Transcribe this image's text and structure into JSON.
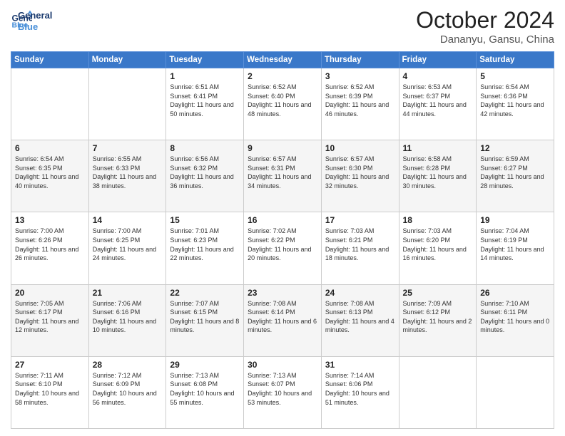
{
  "logo": {
    "line1": "General",
    "line2": "Blue"
  },
  "title": "October 2024",
  "location": "Dananyu, Gansu, China",
  "weekdays": [
    "Sunday",
    "Monday",
    "Tuesday",
    "Wednesday",
    "Thursday",
    "Friday",
    "Saturday"
  ],
  "weeks": [
    [
      {
        "day": "",
        "info": ""
      },
      {
        "day": "",
        "info": ""
      },
      {
        "day": "1",
        "info": "Sunrise: 6:51 AM\nSunset: 6:41 PM\nDaylight: 11 hours and 50 minutes."
      },
      {
        "day": "2",
        "info": "Sunrise: 6:52 AM\nSunset: 6:40 PM\nDaylight: 11 hours and 48 minutes."
      },
      {
        "day": "3",
        "info": "Sunrise: 6:52 AM\nSunset: 6:39 PM\nDaylight: 11 hours and 46 minutes."
      },
      {
        "day": "4",
        "info": "Sunrise: 6:53 AM\nSunset: 6:37 PM\nDaylight: 11 hours and 44 minutes."
      },
      {
        "day": "5",
        "info": "Sunrise: 6:54 AM\nSunset: 6:36 PM\nDaylight: 11 hours and 42 minutes."
      }
    ],
    [
      {
        "day": "6",
        "info": "Sunrise: 6:54 AM\nSunset: 6:35 PM\nDaylight: 11 hours and 40 minutes."
      },
      {
        "day": "7",
        "info": "Sunrise: 6:55 AM\nSunset: 6:33 PM\nDaylight: 11 hours and 38 minutes."
      },
      {
        "day": "8",
        "info": "Sunrise: 6:56 AM\nSunset: 6:32 PM\nDaylight: 11 hours and 36 minutes."
      },
      {
        "day": "9",
        "info": "Sunrise: 6:57 AM\nSunset: 6:31 PM\nDaylight: 11 hours and 34 minutes."
      },
      {
        "day": "10",
        "info": "Sunrise: 6:57 AM\nSunset: 6:30 PM\nDaylight: 11 hours and 32 minutes."
      },
      {
        "day": "11",
        "info": "Sunrise: 6:58 AM\nSunset: 6:28 PM\nDaylight: 11 hours and 30 minutes."
      },
      {
        "day": "12",
        "info": "Sunrise: 6:59 AM\nSunset: 6:27 PM\nDaylight: 11 hours and 28 minutes."
      }
    ],
    [
      {
        "day": "13",
        "info": "Sunrise: 7:00 AM\nSunset: 6:26 PM\nDaylight: 11 hours and 26 minutes."
      },
      {
        "day": "14",
        "info": "Sunrise: 7:00 AM\nSunset: 6:25 PM\nDaylight: 11 hours and 24 minutes."
      },
      {
        "day": "15",
        "info": "Sunrise: 7:01 AM\nSunset: 6:23 PM\nDaylight: 11 hours and 22 minutes."
      },
      {
        "day": "16",
        "info": "Sunrise: 7:02 AM\nSunset: 6:22 PM\nDaylight: 11 hours and 20 minutes."
      },
      {
        "day": "17",
        "info": "Sunrise: 7:03 AM\nSunset: 6:21 PM\nDaylight: 11 hours and 18 minutes."
      },
      {
        "day": "18",
        "info": "Sunrise: 7:03 AM\nSunset: 6:20 PM\nDaylight: 11 hours and 16 minutes."
      },
      {
        "day": "19",
        "info": "Sunrise: 7:04 AM\nSunset: 6:19 PM\nDaylight: 11 hours and 14 minutes."
      }
    ],
    [
      {
        "day": "20",
        "info": "Sunrise: 7:05 AM\nSunset: 6:17 PM\nDaylight: 11 hours and 12 minutes."
      },
      {
        "day": "21",
        "info": "Sunrise: 7:06 AM\nSunset: 6:16 PM\nDaylight: 11 hours and 10 minutes."
      },
      {
        "day": "22",
        "info": "Sunrise: 7:07 AM\nSunset: 6:15 PM\nDaylight: 11 hours and 8 minutes."
      },
      {
        "day": "23",
        "info": "Sunrise: 7:08 AM\nSunset: 6:14 PM\nDaylight: 11 hours and 6 minutes."
      },
      {
        "day": "24",
        "info": "Sunrise: 7:08 AM\nSunset: 6:13 PM\nDaylight: 11 hours and 4 minutes."
      },
      {
        "day": "25",
        "info": "Sunrise: 7:09 AM\nSunset: 6:12 PM\nDaylight: 11 hours and 2 minutes."
      },
      {
        "day": "26",
        "info": "Sunrise: 7:10 AM\nSunset: 6:11 PM\nDaylight: 11 hours and 0 minutes."
      }
    ],
    [
      {
        "day": "27",
        "info": "Sunrise: 7:11 AM\nSunset: 6:10 PM\nDaylight: 10 hours and 58 minutes."
      },
      {
        "day": "28",
        "info": "Sunrise: 7:12 AM\nSunset: 6:09 PM\nDaylight: 10 hours and 56 minutes."
      },
      {
        "day": "29",
        "info": "Sunrise: 7:13 AM\nSunset: 6:08 PM\nDaylight: 10 hours and 55 minutes."
      },
      {
        "day": "30",
        "info": "Sunrise: 7:13 AM\nSunset: 6:07 PM\nDaylight: 10 hours and 53 minutes."
      },
      {
        "day": "31",
        "info": "Sunrise: 7:14 AM\nSunset: 6:06 PM\nDaylight: 10 hours and 51 minutes."
      },
      {
        "day": "",
        "info": ""
      },
      {
        "day": "",
        "info": ""
      }
    ]
  ]
}
